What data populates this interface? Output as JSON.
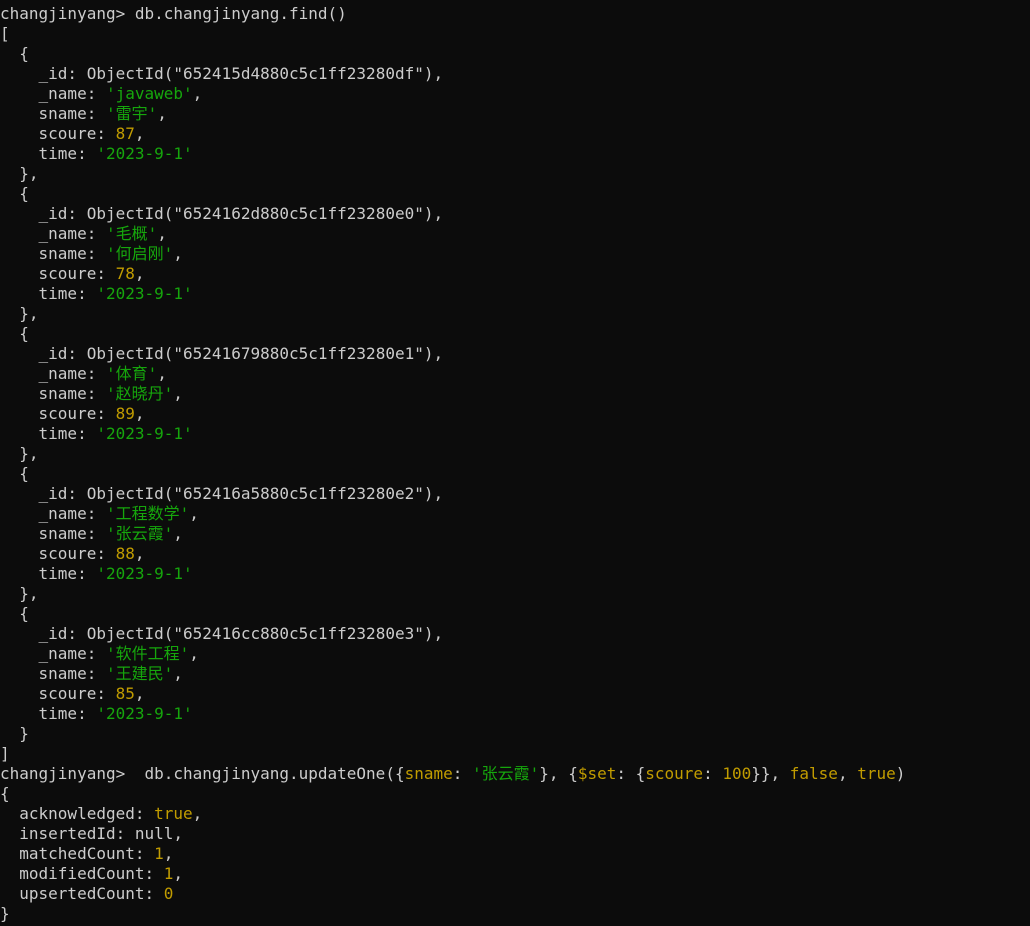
{
  "theme": {
    "background": "#0c0c0c",
    "foreground": "#cccccc",
    "string_color": "#16a60c",
    "number_color": "#c19c00"
  },
  "lines": [
    [
      {
        "t": "changjinyang> ",
        "c": "prompt"
      },
      {
        "t": "db.changjinyang.find()",
        "c": "plain"
      }
    ],
    [
      {
        "t": "[",
        "c": "punct"
      }
    ],
    [
      {
        "t": "  {",
        "c": "punct"
      }
    ],
    [
      {
        "t": "    _id: ",
        "c": "key"
      },
      {
        "t": "ObjectId(\"652415d4880c5c1ff23280df\")",
        "c": "func"
      },
      {
        "t": ",",
        "c": "punct"
      }
    ],
    [
      {
        "t": "    _name: ",
        "c": "key"
      },
      {
        "t": "'javaweb'",
        "c": "str"
      },
      {
        "t": ",",
        "c": "punct"
      }
    ],
    [
      {
        "t": "    sname: ",
        "c": "key"
      },
      {
        "t": "'雷宇'",
        "c": "str"
      },
      {
        "t": ",",
        "c": "punct"
      }
    ],
    [
      {
        "t": "    scoure: ",
        "c": "key"
      },
      {
        "t": "87",
        "c": "num"
      },
      {
        "t": ",",
        "c": "punct"
      }
    ],
    [
      {
        "t": "    time: ",
        "c": "key"
      },
      {
        "t": "'2023-9-1'",
        "c": "str"
      }
    ],
    [
      {
        "t": "  },",
        "c": "punct"
      }
    ],
    [
      {
        "t": "  {",
        "c": "punct"
      }
    ],
    [
      {
        "t": "    _id: ",
        "c": "key"
      },
      {
        "t": "ObjectId(\"6524162d880c5c1ff23280e0\")",
        "c": "func"
      },
      {
        "t": ",",
        "c": "punct"
      }
    ],
    [
      {
        "t": "    _name: ",
        "c": "key"
      },
      {
        "t": "'毛概'",
        "c": "str"
      },
      {
        "t": ",",
        "c": "punct"
      }
    ],
    [
      {
        "t": "    sname: ",
        "c": "key"
      },
      {
        "t": "'何启刚'",
        "c": "str"
      },
      {
        "t": ",",
        "c": "punct"
      }
    ],
    [
      {
        "t": "    scoure: ",
        "c": "key"
      },
      {
        "t": "78",
        "c": "num"
      },
      {
        "t": ",",
        "c": "punct"
      }
    ],
    [
      {
        "t": "    time: ",
        "c": "key"
      },
      {
        "t": "'2023-9-1'",
        "c": "str"
      }
    ],
    [
      {
        "t": "  },",
        "c": "punct"
      }
    ],
    [
      {
        "t": "  {",
        "c": "punct"
      }
    ],
    [
      {
        "t": "    _id: ",
        "c": "key"
      },
      {
        "t": "ObjectId(\"65241679880c5c1ff23280e1\")",
        "c": "func"
      },
      {
        "t": ",",
        "c": "punct"
      }
    ],
    [
      {
        "t": "    _name: ",
        "c": "key"
      },
      {
        "t": "'体育'",
        "c": "str"
      },
      {
        "t": ",",
        "c": "punct"
      }
    ],
    [
      {
        "t": "    sname: ",
        "c": "key"
      },
      {
        "t": "'赵晓丹'",
        "c": "str"
      },
      {
        "t": ",",
        "c": "punct"
      }
    ],
    [
      {
        "t": "    scoure: ",
        "c": "key"
      },
      {
        "t": "89",
        "c": "num"
      },
      {
        "t": ",",
        "c": "punct"
      }
    ],
    [
      {
        "t": "    time: ",
        "c": "key"
      },
      {
        "t": "'2023-9-1'",
        "c": "str"
      }
    ],
    [
      {
        "t": "  },",
        "c": "punct"
      }
    ],
    [
      {
        "t": "  {",
        "c": "punct"
      }
    ],
    [
      {
        "t": "    _id: ",
        "c": "key"
      },
      {
        "t": "ObjectId(\"652416a5880c5c1ff23280e2\")",
        "c": "func"
      },
      {
        "t": ",",
        "c": "punct"
      }
    ],
    [
      {
        "t": "    _name: ",
        "c": "key"
      },
      {
        "t": "'工程数学'",
        "c": "str"
      },
      {
        "t": ",",
        "c": "punct"
      }
    ],
    [
      {
        "t": "    sname: ",
        "c": "key"
      },
      {
        "t": "'张云霞'",
        "c": "str"
      },
      {
        "t": ",",
        "c": "punct"
      }
    ],
    [
      {
        "t": "    scoure: ",
        "c": "key"
      },
      {
        "t": "88",
        "c": "num"
      },
      {
        "t": ",",
        "c": "punct"
      }
    ],
    [
      {
        "t": "    time: ",
        "c": "key"
      },
      {
        "t": "'2023-9-1'",
        "c": "str"
      }
    ],
    [
      {
        "t": "  },",
        "c": "punct"
      }
    ],
    [
      {
        "t": "  {",
        "c": "punct"
      }
    ],
    [
      {
        "t": "    _id: ",
        "c": "key"
      },
      {
        "t": "ObjectId(\"652416cc880c5c1ff23280e3\")",
        "c": "func"
      },
      {
        "t": ",",
        "c": "punct"
      }
    ],
    [
      {
        "t": "    _name: ",
        "c": "key"
      },
      {
        "t": "'软件工程'",
        "c": "str"
      },
      {
        "t": ",",
        "c": "punct"
      }
    ],
    [
      {
        "t": "    sname: ",
        "c": "key"
      },
      {
        "t": "'王建民'",
        "c": "str"
      },
      {
        "t": ",",
        "c": "punct"
      }
    ],
    [
      {
        "t": "    scoure: ",
        "c": "key"
      },
      {
        "t": "85",
        "c": "num"
      },
      {
        "t": ",",
        "c": "punct"
      }
    ],
    [
      {
        "t": "    time: ",
        "c": "key"
      },
      {
        "t": "'2023-9-1'",
        "c": "str"
      }
    ],
    [
      {
        "t": "  }",
        "c": "punct"
      }
    ],
    [
      {
        "t": "]",
        "c": "punct"
      }
    ],
    [
      {
        "t": "changjinyang> ",
        "c": "prompt"
      },
      {
        "t": " db.changjinyang.updateOne({",
        "c": "plain"
      },
      {
        "t": "sname",
        "c": "op"
      },
      {
        "t": ": ",
        "c": "plain"
      },
      {
        "t": "'张云霞'",
        "c": "str"
      },
      {
        "t": "}, {",
        "c": "plain"
      },
      {
        "t": "$set",
        "c": "op"
      },
      {
        "t": ": {",
        "c": "plain"
      },
      {
        "t": "scoure",
        "c": "op"
      },
      {
        "t": ": ",
        "c": "plain"
      },
      {
        "t": "100",
        "c": "num"
      },
      {
        "t": "}}, ",
        "c": "plain"
      },
      {
        "t": "false",
        "c": "bool"
      },
      {
        "t": ", ",
        "c": "plain"
      },
      {
        "t": "true",
        "c": "bool"
      },
      {
        "t": ")",
        "c": "plain"
      }
    ],
    [
      {
        "t": "{",
        "c": "punct"
      }
    ],
    [
      {
        "t": "  acknowledged: ",
        "c": "key"
      },
      {
        "t": "true",
        "c": "bool"
      },
      {
        "t": ",",
        "c": "punct"
      }
    ],
    [
      {
        "t": "  insertedId: ",
        "c": "key"
      },
      {
        "t": "null",
        "c": "null"
      },
      {
        "t": ",",
        "c": "punct"
      }
    ],
    [
      {
        "t": "  matchedCount: ",
        "c": "key"
      },
      {
        "t": "1",
        "c": "num"
      },
      {
        "t": ",",
        "c": "punct"
      }
    ],
    [
      {
        "t": "  modifiedCount: ",
        "c": "key"
      },
      {
        "t": "1",
        "c": "num"
      },
      {
        "t": ",",
        "c": "punct"
      }
    ],
    [
      {
        "t": "  upsertedCount: ",
        "c": "key"
      },
      {
        "t": "0",
        "c": "num"
      }
    ],
    [
      {
        "t": "}",
        "c": "punct"
      }
    ]
  ]
}
